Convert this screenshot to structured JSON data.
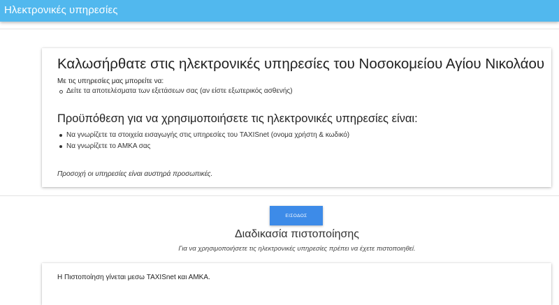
{
  "header": {
    "title": "Ηλεκτρονικές υπηρεσίες"
  },
  "intro_card": {
    "heading": "Καλωσήρθατε στις ηλεκτρονικές υπηρεσίες του Νοσοκομείου Αγίου Νικολάου",
    "intro": "Με τις υπηρεσίες μας μπορείτε να:",
    "services": [
      "Δείτε τα αποτελέσματα των εξετάσεων σας (αν είστε εξωτερικός ασθενής)"
    ],
    "prereq_heading": "Προϋπόθεση για να χρησιμοποιήσετε τις ηλεκτρονικές υπηρεσίες είναι:",
    "prereqs": [
      "Να γνωρίζετε τα στοιχεία εισαγωγής στις υπηρεσίες του TAXISnet (ονομα χρήστη & κωδικό)",
      "Να γνωρίζετε το ΑΜΚΑ σας"
    ],
    "note": "Προσοχή οι υπηρεσίες είναι αυστηρά προσωπικές."
  },
  "login_button": {
    "label": "ΕΙΣΟΔΟΣ"
  },
  "auth_section": {
    "title": "Διαδικασία πιστοποίησης",
    "subtitle": "Για να χρησιμοποιήσετε τις ηλεκτρονικές υπηρεσίες πρέπει να έχετε πιστοποιηθεί.",
    "card_text": "Η Πιστοποίηση γίνεται μεσω TAXISnet και ΑΜΚΑ."
  },
  "colors": {
    "topbar": "#51b8ee",
    "button": "#3d8be8"
  }
}
